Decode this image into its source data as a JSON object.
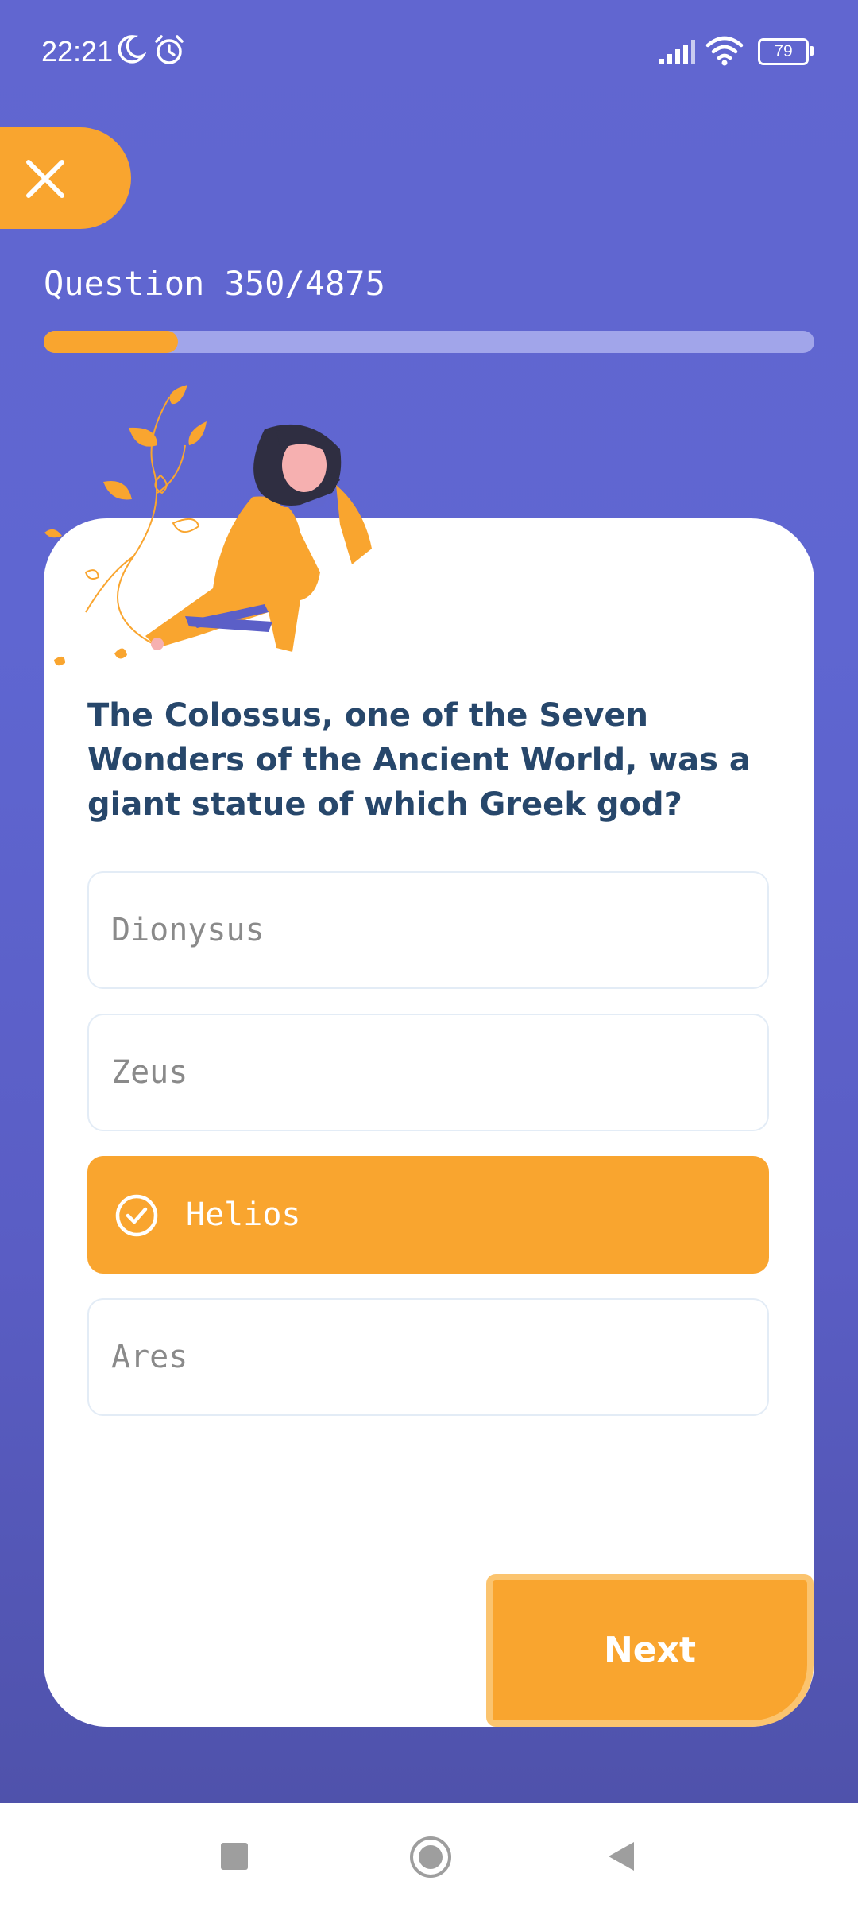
{
  "status_bar": {
    "time": "22:21",
    "battery": "79",
    "icons": [
      "moon-icon",
      "alarm-icon",
      "signal-icon",
      "wifi-icon",
      "battery-icon"
    ]
  },
  "quiz": {
    "counter": "Question 350/4875",
    "progress": 0.174,
    "question": "The Colossus, one of the Seven Wonders of the Ancient World, was a giant statue of which Greek god?",
    "answers": [
      {
        "label": "Dionysus",
        "selected": false
      },
      {
        "label": "Zeus",
        "selected": false
      },
      {
        "label": "Helios",
        "selected": true
      },
      {
        "label": "Ares",
        "selected": false
      }
    ],
    "next_label": "Next"
  },
  "colors": {
    "background": "#6066cf",
    "accent": "#f9a52f",
    "question_text": "#27476b",
    "progress_track": "#a1a5ea"
  },
  "nav": {
    "icons": [
      "recent-apps-icon",
      "home-icon",
      "back-icon"
    ]
  }
}
